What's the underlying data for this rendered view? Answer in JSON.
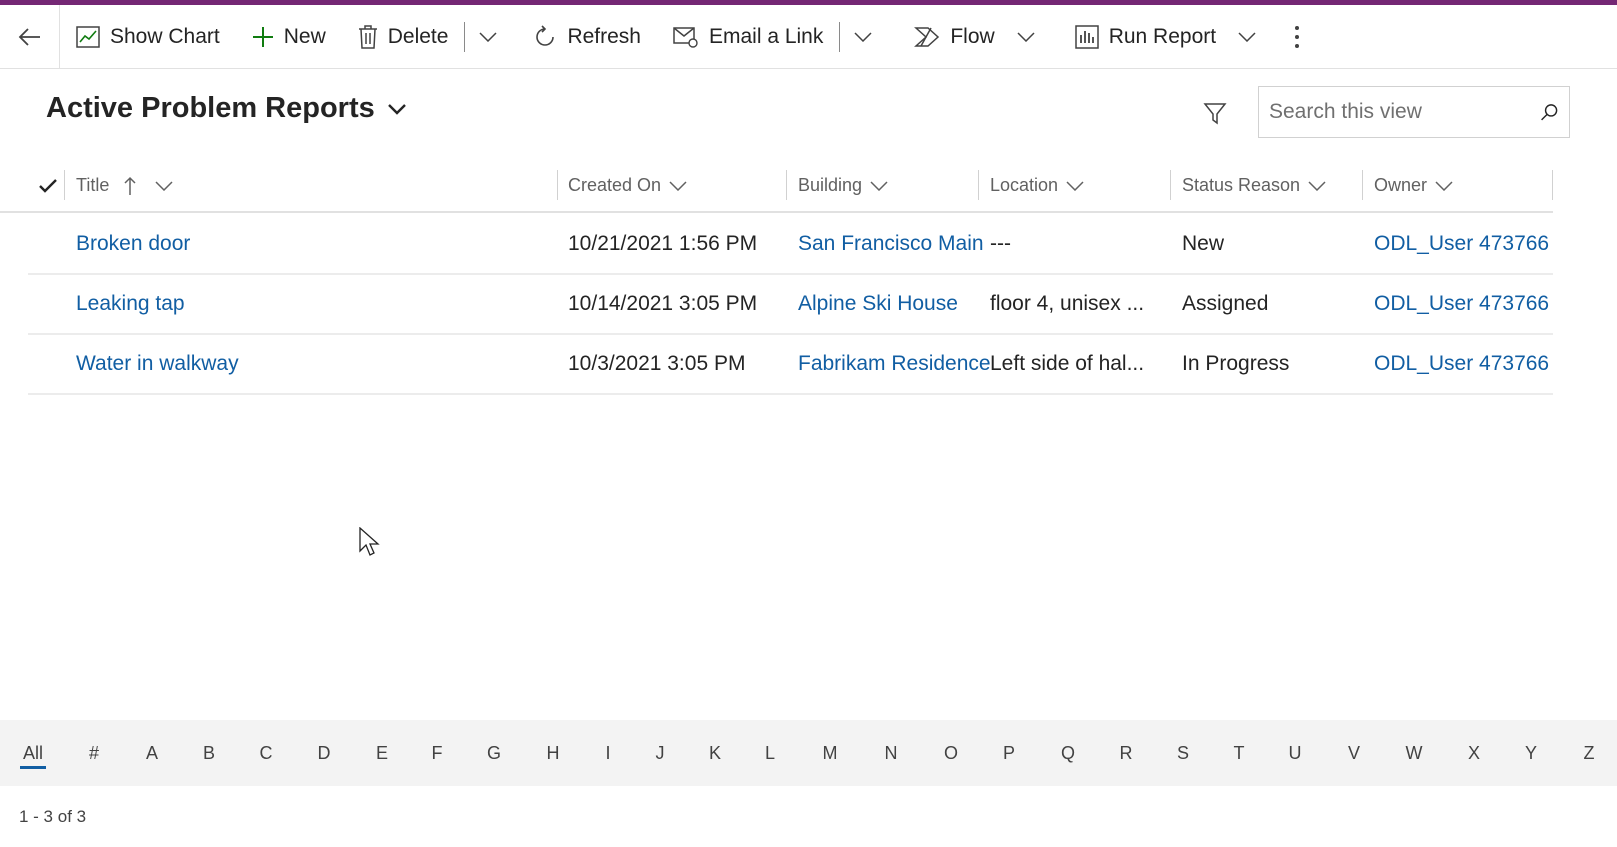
{
  "commandbar": {
    "show_chart": "Show Chart",
    "new": "New",
    "delete": "Delete",
    "refresh": "Refresh",
    "email_link": "Email a Link",
    "flow": "Flow",
    "run_report": "Run Report"
  },
  "view": {
    "title": "Active Problem Reports",
    "search_placeholder": "Search this view"
  },
  "columns": {
    "title": "Title",
    "created_on": "Created On",
    "building": "Building",
    "location": "Location",
    "status_reason": "Status Reason",
    "owner": "Owner"
  },
  "rows": [
    {
      "title": "Broken door",
      "created_on": "10/21/2021 1:56 PM",
      "building": "San Francisco Main",
      "location": "---",
      "status_reason": "New",
      "owner": "ODL_User 473766"
    },
    {
      "title": "Leaking tap",
      "created_on": "10/14/2021 3:05 PM",
      "building": "Alpine Ski House",
      "location": "floor 4, unisex ...",
      "status_reason": "Assigned",
      "owner": "ODL_User 473766"
    },
    {
      "title": "Water in walkway",
      "created_on": "10/3/2021 3:05 PM",
      "building": "Fabrikam Residence",
      "location": "Left side of hal...",
      "status_reason": "In Progress",
      "owner": "ODL_User 473766"
    }
  ],
  "jumpbar": {
    "items": [
      "All",
      "#",
      "A",
      "B",
      "C",
      "D",
      "E",
      "F",
      "G",
      "H",
      "I",
      "J",
      "K",
      "L",
      "M",
      "N",
      "O",
      "P",
      "Q",
      "R",
      "S",
      "T",
      "U",
      "V",
      "W",
      "X",
      "Y",
      "Z"
    ],
    "selected": "All"
  },
  "footer": {
    "record_count": "1 - 3 of 3"
  },
  "colors": {
    "accent_bar": "#742774",
    "link": "#115ea3",
    "new_icon": "#107c10"
  }
}
